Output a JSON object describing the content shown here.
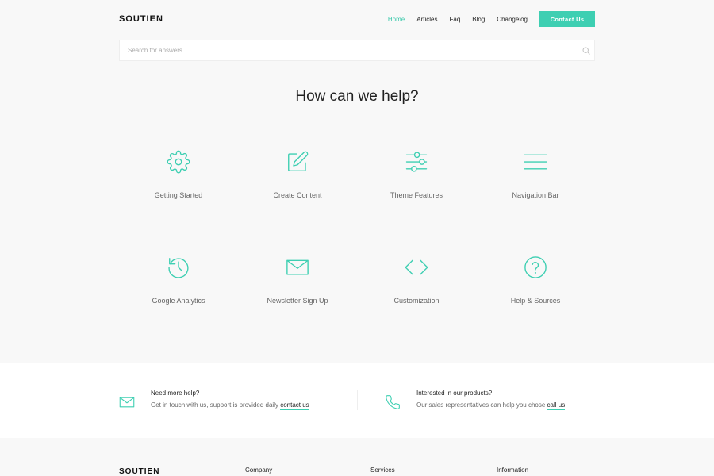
{
  "brand": {
    "logo": "SOUTIEN"
  },
  "nav": {
    "items": [
      {
        "label": "Home",
        "active": true
      },
      {
        "label": "Articles",
        "active": false
      },
      {
        "label": "Faq",
        "active": false
      },
      {
        "label": "Blog",
        "active": false
      },
      {
        "label": "Changelog",
        "active": false
      }
    ],
    "cta_label": "Contact Us"
  },
  "search": {
    "placeholder": "Search for answers",
    "icon": "search-icon"
  },
  "hero": {
    "title": "How can we help?"
  },
  "categories": [
    {
      "label": "Getting Started",
      "icon": "gear-icon"
    },
    {
      "label": "Create Content",
      "icon": "edit-icon"
    },
    {
      "label": "Theme Features",
      "icon": "sliders-icon"
    },
    {
      "label": "Navigation Bar",
      "icon": "menu-icon"
    },
    {
      "label": "Google Analytics",
      "icon": "history-icon"
    },
    {
      "label": "Newsletter Sign Up",
      "icon": "mail-icon"
    },
    {
      "label": "Customization",
      "icon": "code-icon"
    },
    {
      "label": "Help & Sources",
      "icon": "help-icon"
    }
  ],
  "support": {
    "left": {
      "title": "Need more help?",
      "text": "Get in touch with us, support is provided daily",
      "link": "contact us",
      "icon": "mail-icon"
    },
    "right": {
      "title": "Interested in our products?",
      "text": "Our sales representatives can help you chose",
      "link": "call us",
      "icon": "phone-icon"
    }
  },
  "footer": {
    "logo": "SOUTIEN",
    "columns": [
      "Company",
      "Services",
      "Information"
    ]
  },
  "colors": {
    "accent": "#3ecfb2",
    "background": "#f8f8f8",
    "text": "#222222"
  }
}
